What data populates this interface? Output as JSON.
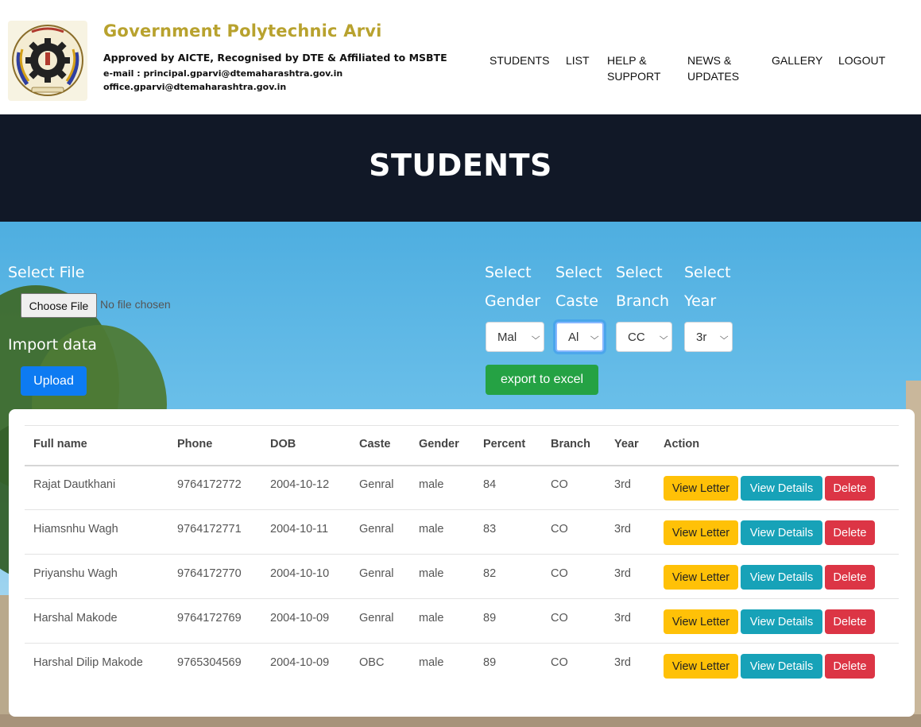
{
  "header": {
    "college_name": "Government Polytechnic Arvi",
    "approved": "Approved by AICTE, Recognised by DTE & Affiliated to MSBTE",
    "email_line1": "e-mail : principal.gparvi@dtemaharashtra.gov.in",
    "email_line2": "office.gparvi@dtemaharashtra.gov.in",
    "nav": [
      "STUDENTS",
      "LIST",
      "HELP &",
      "SUPPORT",
      "NEWS &",
      "UPDATES",
      "GALLERY",
      "LOGOUT"
    ]
  },
  "hero": {
    "title": "STUDENTS"
  },
  "upload": {
    "select_file_label": "Select File",
    "choose_file": "Choose File",
    "file_status": "No file chosen",
    "import_label": "Import data",
    "upload_button": "Upload"
  },
  "filters": {
    "select_word": "Select",
    "gender_label": "Gender",
    "caste_label": "Caste",
    "branch_label": "Branch",
    "year_label": "Year",
    "gender_value": "Mal",
    "caste_value": "Al",
    "branch_value": "CC",
    "year_value": "3r",
    "export_button": "export to excel"
  },
  "table": {
    "headers": [
      "Full name",
      "Phone",
      "DOB",
      "Caste",
      "Gender",
      "Percent",
      "Branch",
      "Year",
      "Action"
    ],
    "rows": [
      [
        "Rajat Dautkhani",
        "9764172772",
        "2004-10-12",
        "Genral",
        "male",
        "84",
        "CO",
        "3rd"
      ],
      [
        "Hiamsnhu Wagh",
        "9764172771",
        "2004-10-11",
        "Genral",
        "male",
        "83",
        "CO",
        "3rd"
      ],
      [
        "Priyanshu Wagh",
        "9764172770",
        "2004-10-10",
        "Genral",
        "male",
        "82",
        "CO",
        "3rd"
      ],
      [
        "Harshal Makode",
        "9764172769",
        "2004-10-09",
        "Genral",
        "male",
        "89",
        "CO",
        "3rd"
      ],
      [
        "Harshal Dilip Makode",
        "9765304569",
        "2004-10-09",
        "OBC",
        "male",
        "89",
        "CO",
        "3rd"
      ]
    ],
    "actions": {
      "letter": "View Letter",
      "details": "View Details",
      "delete": "Delete"
    }
  },
  "colors": {
    "brand_gold": "#b8a22e",
    "hero_bg": "#111827",
    "upload_blue": "#0d7bf2",
    "export_green": "#25a244",
    "letter_yellow": "#ffc107",
    "details_teal": "#17a2b8",
    "delete_red": "#dc3545"
  }
}
